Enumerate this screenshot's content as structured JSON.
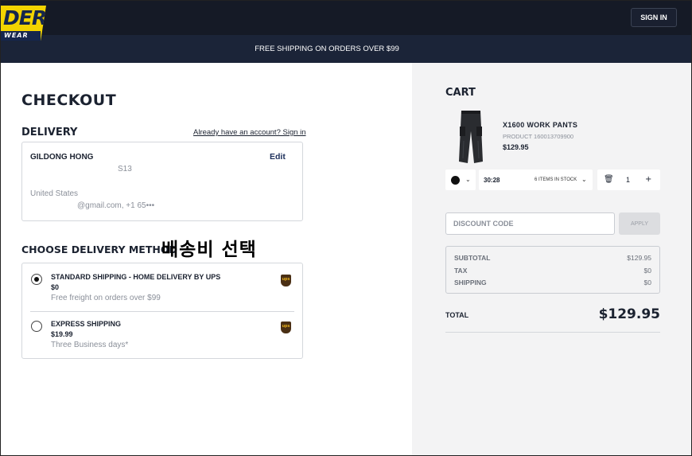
{
  "header": {
    "logo_main": "DER",
    "logo_sub": "WEAR",
    "sign_in_label": "SIGN IN",
    "banner": "FREE SHIPPING ON ORDERS OVER $99"
  },
  "checkout": {
    "title": "CHECKOUT",
    "delivery_heading": "DELIVERY",
    "account_link": "Already have an account? Sign in",
    "address": {
      "name": "GILDONG HONG",
      "edit_label": "Edit",
      "line1": "S13",
      "country": "United States",
      "contact": "@gmail.com, +1 65•••"
    },
    "method_heading": "CHOOSE DELIVERY METHOD",
    "annotation": "배송비 선택",
    "options": [
      {
        "title": "STANDARD SHIPPING - HOME DELIVERY BY UPS",
        "price": "$0",
        "note": "Free freight on orders over $99",
        "selected": true,
        "icon": "ups-icon"
      },
      {
        "title": "EXPRESS SHIPPING",
        "price": "$19.99",
        "note": "Three Business days*",
        "selected": false,
        "icon": "ups-icon"
      }
    ]
  },
  "cart": {
    "heading": "CART",
    "item": {
      "name": "X1600 WORK PANTS",
      "product_number": "PRODUCT 160013709900",
      "price": "$129.95",
      "color_icon": "black-color-swatch",
      "size": "30:28",
      "stock": "6 ITEMS IN STOCK",
      "quantity": "1"
    },
    "discount_placeholder": "DISCOUNT CODE",
    "apply_label": "APPLY",
    "summary": {
      "subtotal_label": "SUBTOTAL",
      "subtotal": "$129.95",
      "tax_label": "TAX",
      "tax": "$0",
      "shipping_label": "SHIPPING",
      "shipping": "$0"
    },
    "total_label": "TOTAL",
    "total": "$129.95"
  },
  "colors": {
    "header_bg": "#151a26",
    "banner_bg": "#1b2438",
    "brand_yellow": "#f3d400",
    "brand_navy": "#15264d",
    "cart_bg": "#f3f3f4"
  }
}
